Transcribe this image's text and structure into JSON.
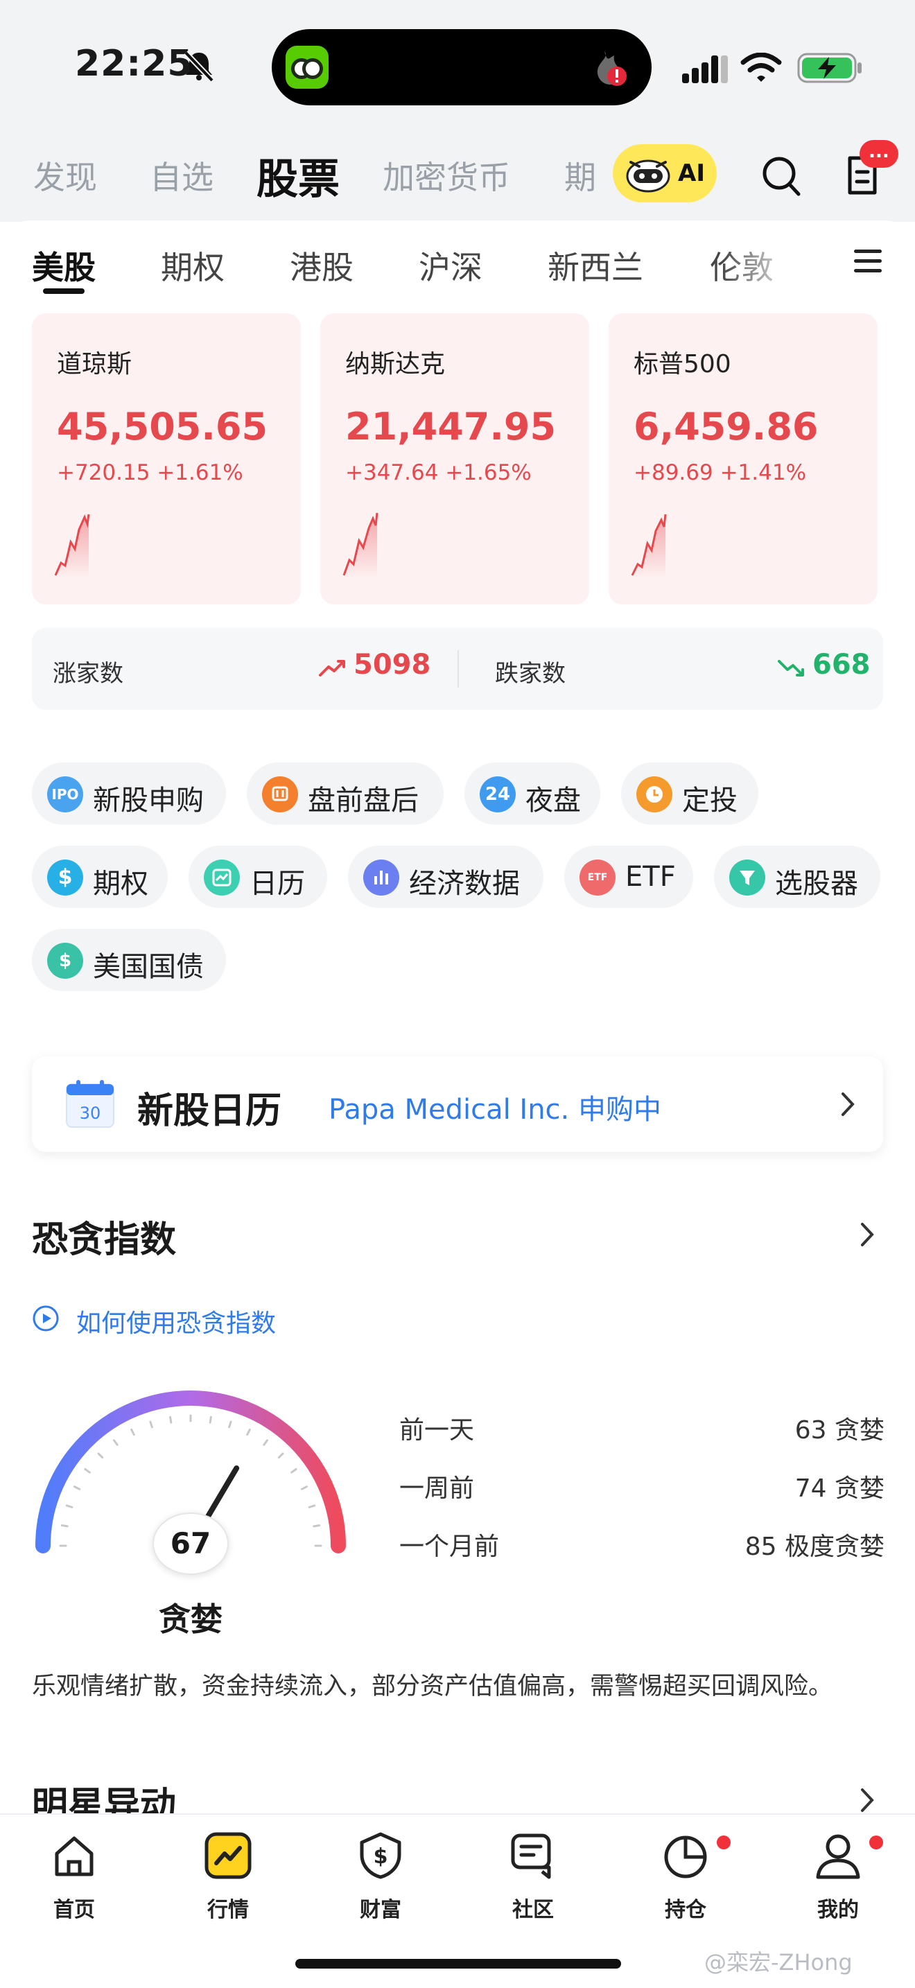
{
  "status_bar": {
    "time": "22:25"
  },
  "top_tabs": [
    "发现",
    "自选",
    "股票",
    "加密货币",
    "期"
  ],
  "ai_label": "AI",
  "msg_badge": "...",
  "sub_tabs": [
    "美股",
    "期权",
    "港股",
    "沪深",
    "新西兰",
    "伦敦"
  ],
  "indices": [
    {
      "name": "道琼斯",
      "value": "45,505.65",
      "change": "+720.15 +1.61%"
    },
    {
      "name": "纳斯达克",
      "value": "21,447.95",
      "change": "+347.64 +1.65%"
    },
    {
      "name": "标普500",
      "value": "6,459.86",
      "change": "+89.69 +1.41%"
    }
  ],
  "breadth": {
    "up_label": "涨家数",
    "up_value": "5098",
    "down_label": "跌家数",
    "down_value": "668",
    "up_color": "#e5484d",
    "down_color": "#21b36b"
  },
  "features": [
    {
      "label": "新股申购",
      "icon": "ipo-icon",
      "icon_text": "IPO",
      "color": "#4aa3ef"
    },
    {
      "label": "盘前盘后",
      "icon": "premarket-icon",
      "icon_text": "",
      "color": "#f47f2c"
    },
    {
      "label": "夜盘",
      "icon": "night-session-icon",
      "icon_text": "24",
      "color": "#3f9bf0"
    },
    {
      "label": "定投",
      "icon": "clock-icon",
      "icon_text": "",
      "color": "#f59a2c"
    },
    {
      "label": "期权",
      "icon": "dollar-icon",
      "icon_text": "$",
      "color": "#27b0e6"
    },
    {
      "label": "日历",
      "icon": "calendar-icon",
      "icon_text": "",
      "color": "#3ccfb1"
    },
    {
      "label": "经济数据",
      "icon": "bar-chart-icon",
      "icon_text": "",
      "color": "#6b7ff0"
    },
    {
      "label": "ETF",
      "icon": "etf-icon",
      "icon_text": "ETF",
      "color": "#ef6a6a"
    },
    {
      "label": "选股器",
      "icon": "filter-icon",
      "icon_text": "",
      "color": "#36c7a8"
    },
    {
      "label": "美国国债",
      "icon": "bond-icon",
      "icon_text": "$",
      "color": "#39c2a6"
    }
  ],
  "ipo_calendar": {
    "title": "新股日历",
    "subtitle": "Papa Medical Inc. 申购中",
    "day": "30"
  },
  "fear_greed": {
    "title": "恐贪指数",
    "howto": "如何使用恐贪指数",
    "value": "67",
    "label": "贪婪",
    "level": 0.67,
    "stats": [
      {
        "k": "前一天",
        "v": "63 贪婪"
      },
      {
        "k": "一周前",
        "v": "74 贪婪"
      },
      {
        "k": "一个月前",
        "v": "85 极度贪婪"
      }
    ],
    "summary": "乐观情绪扩散，资金持续流入，部分资产估值偏高，需警惕超买回调风险。"
  },
  "star_movers_title": "明星异动",
  "bottom_nav": [
    {
      "label": "首页",
      "icon": "home-icon"
    },
    {
      "label": "行情",
      "icon": "market-icon"
    },
    {
      "label": "财富",
      "icon": "wealth-icon"
    },
    {
      "label": "社区",
      "icon": "community-icon"
    },
    {
      "label": "持仓",
      "icon": "portfolio-icon"
    },
    {
      "label": "我的",
      "icon": "profile-icon"
    }
  ],
  "watermark": "@栾宏-ZHong"
}
